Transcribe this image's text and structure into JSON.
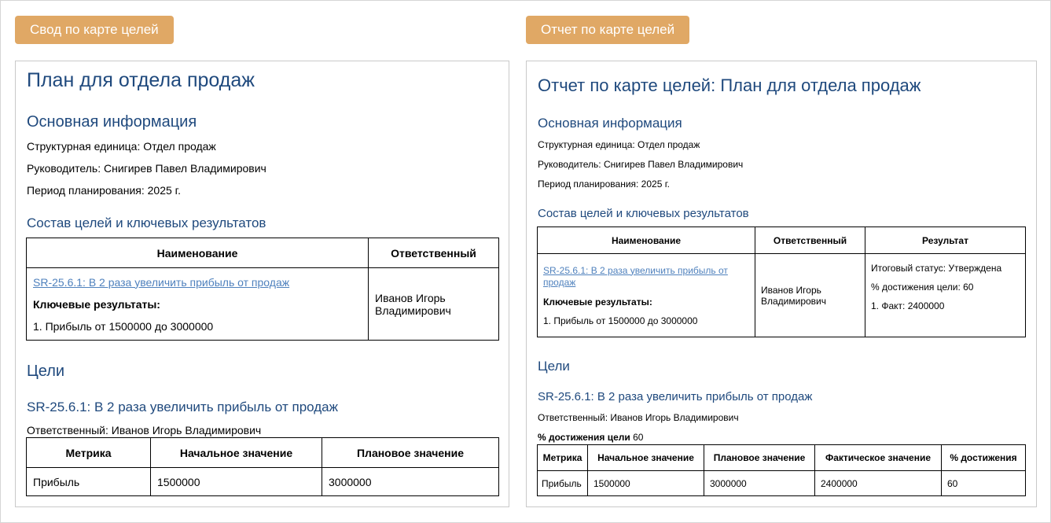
{
  "tabs": {
    "summary": "Свод по карте целей",
    "report": "Отчет по карте целей"
  },
  "left": {
    "title": "План для отдела продаж",
    "basic_heading": "Основная информация",
    "unit": "Структурная единица: Отдел продаж",
    "manager": "Руководитель: Снигирев Павел Владимирович",
    "period": "Период планирования: 2025 г.",
    "composition_heading": "Состав целей и ключевых результатов",
    "composition_table": {
      "headers": [
        "Наименование",
        "Ответственный"
      ],
      "goal_link": "SR-25.6.1: В 2 раза увеличить прибыль от продаж",
      "kr_label": "Ключевые результаты:",
      "kr_item": "1. Прибыль от 1500000 до 3000000",
      "responsible": "Иванов Игорь Владимирович"
    },
    "goals_heading": "Цели",
    "goal_title": "SR-25.6.1: В 2 раза увеличить прибыль от продаж",
    "goal_responsible": "Ответственный: Иванов Игорь Владимирович",
    "metrics_table": {
      "headers": [
        "Метрика",
        "Начальное значение",
        "Плановое значение"
      ],
      "row": [
        "Прибыль",
        "1500000",
        "3000000"
      ]
    }
  },
  "right": {
    "title": "Отчет по карте целей: План для отдела продаж",
    "basic_heading": "Основная информация",
    "unit": "Структурная единица: Отдел продаж",
    "manager": "Руководитель: Снигирев Павел Владимирович",
    "period": "Период планирования: 2025 г.",
    "composition_heading": "Состав целей и ключевых результатов",
    "composition_table": {
      "headers": [
        "Наименование",
        "Ответственный",
        "Результат"
      ],
      "goal_link": "SR-25.6.1: В 2 раза увеличить прибыль от продаж",
      "kr_label": "Ключевые результаты:",
      "kr_item": "1. Прибыль от 1500000 до 3000000",
      "responsible": "Иванов Игорь Владимирович",
      "result_status": "Итоговый статус: Утверждена",
      "result_percent": "% достижения цели: 60",
      "result_fact": "1. Факт: 2400000"
    },
    "goals_heading": "Цели",
    "goal_title": "SR-25.6.1: В 2 раза увеличить прибыль от продаж",
    "goal_responsible": "Ответственный: Иванов Игорь Владимирович",
    "achievement_label": "% достижения цели",
    "achievement_value": "60",
    "metrics_table": {
      "headers": [
        "Метрика",
        "Начальное значение",
        "Плановое значение",
        "Фактическое значение",
        "% достижения"
      ],
      "row": [
        "Прибыль",
        "1500000",
        "3000000",
        "2400000",
        "60"
      ]
    }
  }
}
